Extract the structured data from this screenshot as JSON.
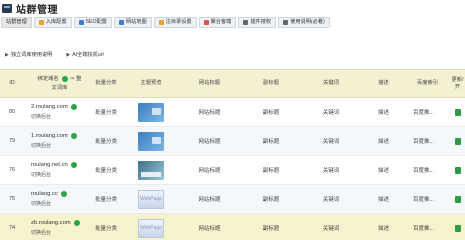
{
  "app": {
    "title": "站群管理",
    "icon": "app-window-icon"
  },
  "toolbar": [
    {
      "label": "站群管理",
      "active": true,
      "icon": ""
    },
    {
      "label": "入库配置",
      "icon": "orange",
      "color": "#e8a23a"
    },
    {
      "label": "SEO配置",
      "icon": "blue",
      "color": "#3b7fd0"
    },
    {
      "label": "网站地图",
      "icon": "blue",
      "color": "#3b7fd0"
    },
    {
      "label": "注目录设置",
      "icon": "orange",
      "color": "#e8a23a"
    },
    {
      "label": "聚合客端",
      "icon": "red",
      "color": "#d9534f"
    },
    {
      "label": "插件授权",
      "icon": "gray",
      "color": "#666666"
    },
    {
      "label": "使用说明(必看)",
      "icon": "gray",
      "color": "#666666"
    }
  ],
  "links": {
    "help": "独立词库使用说明",
    "ai": "AI全端找机url"
  },
  "table": {
    "headers": {
      "id": "ID",
      "domain_line1": "绑定域名",
      "domain_line2": "文词库",
      "category": "批量分类",
      "thumb": "主题预览",
      "web_title": "网站标题",
      "sub_title": "副标题",
      "keywords": "关键词",
      "description": "描述",
      "index": "百度索引",
      "update": "更新/开"
    },
    "rows": [
      {
        "id": "80",
        "domain": "2.roulang.com",
        "sub": "切换后台",
        "category": "批量分类",
        "theme": "win7",
        "web_title": "网站标题",
        "sub_title": "副标题",
        "keywords": "关键词",
        "description": "描述",
        "index": "百度推..."
      },
      {
        "id": "79",
        "domain": "1.roulang.com",
        "sub": "切换后台",
        "category": "批量分类",
        "theme": "win7",
        "web_title": "网站标题",
        "sub_title": "副标题",
        "keywords": "关键词",
        "description": "描述",
        "index": "百度推..."
      },
      {
        "id": "76",
        "domain": "roulang.net.cn",
        "sub": "切换后台",
        "category": "批量分类",
        "theme": "sick",
        "web_title": "网站标题",
        "sub_title": "副标题",
        "keywords": "关键词",
        "description": "描述",
        "index": "百度推..."
      },
      {
        "id": "75",
        "domain": "roulang.cc",
        "sub": "切换后台",
        "category": "批量分类",
        "theme": "WebPage",
        "web_title": "网站标题",
        "sub_title": "副标题",
        "keywords": "关键词",
        "description": "描述",
        "index": "百度推..."
      },
      {
        "id": "74",
        "domain": "zb.roulang.com",
        "sub": "切换后台",
        "category": "批量分类",
        "theme": "WebPage",
        "web_title": "网站标题",
        "sub_title": "副标题",
        "keywords": "关键词",
        "description": "描述",
        "index": "百度推..."
      }
    ]
  },
  "colors": {
    "header_bg": "#f4f1d2",
    "highlight_bg": "#f6f2cc",
    "accent_green": "#2f9a49"
  }
}
